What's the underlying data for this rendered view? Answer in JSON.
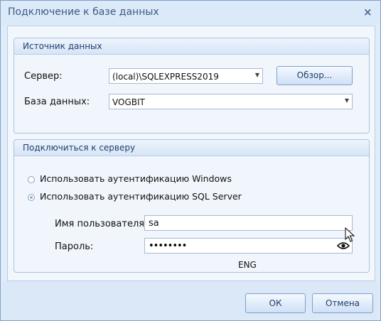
{
  "window": {
    "title": "Подключение к базе данных",
    "close_symbol": "×"
  },
  "source_group": {
    "title": "Источник данных",
    "server_label": "Сервер:",
    "server_value": "(local)\\SQLEXPRESS2019",
    "browse_label": "Обзор...",
    "database_label": "База данных:",
    "database_value": "VOGBIT"
  },
  "connect_group": {
    "title": "Подключиться к серверу",
    "auth_windows_label": "Использовать аутентификацию Windows",
    "auth_sql_label": "Использовать аутентификацию SQL Server",
    "selected_auth": "sql",
    "username_label": "Имя пользователя:",
    "username_value": "sa",
    "password_label": "Пароль:",
    "password_masked": "••••••••",
    "keyboard_layout": "ENG"
  },
  "footer": {
    "ok_label": "ОК",
    "cancel_label": "Отмена"
  },
  "icons": [
    "close-icon",
    "dropdown-arrow-icon",
    "eye-icon",
    "mouse-cursor-icon"
  ],
  "colors": {
    "frame": "#7d9fc8",
    "group_border": "#a9c2e2",
    "title_text": "#3a5b86"
  }
}
